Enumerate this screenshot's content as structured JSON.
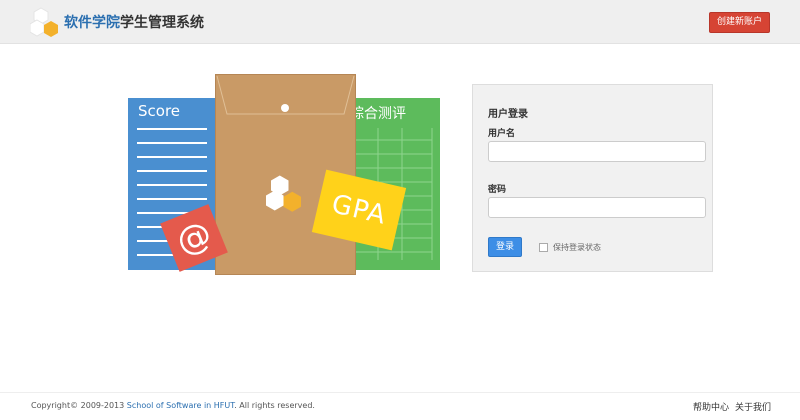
{
  "header": {
    "logo_icon": "hexagon-logo-icon",
    "brand_highlight": "软件学院",
    "brand_rest": "学生管理系统",
    "create_account_label": "创建新账户",
    "colors": {
      "brand": "#2b6fb0",
      "create_button": "#d64434"
    }
  },
  "illustration": {
    "score_card_title": "Score",
    "green_card_title": "综合测评",
    "at_symbol": "@",
    "gpa_label": "GPA",
    "colors": {
      "score": "#4a8fd0",
      "envelope": "#c99a66",
      "green": "#5dbb5c",
      "at_card": "#e45a4c",
      "gpa_card": "#ffd21a"
    }
  },
  "login": {
    "title": "用户登录",
    "username_label": "用户名",
    "username_value": "",
    "password_label": "密码",
    "password_value": "",
    "submit_label": "登录",
    "remember_label": "保持登录状态",
    "remember_checked": false,
    "colors": {
      "submit": "#3d8ee6"
    }
  },
  "footer": {
    "copyright_prefix": "Copyright© 2009-2013 ",
    "copyright_link": "School of Software in HFUT",
    "copyright_suffix": ". All rights reserved.",
    "help_label": "帮助中心",
    "about_label": "关于我们"
  }
}
